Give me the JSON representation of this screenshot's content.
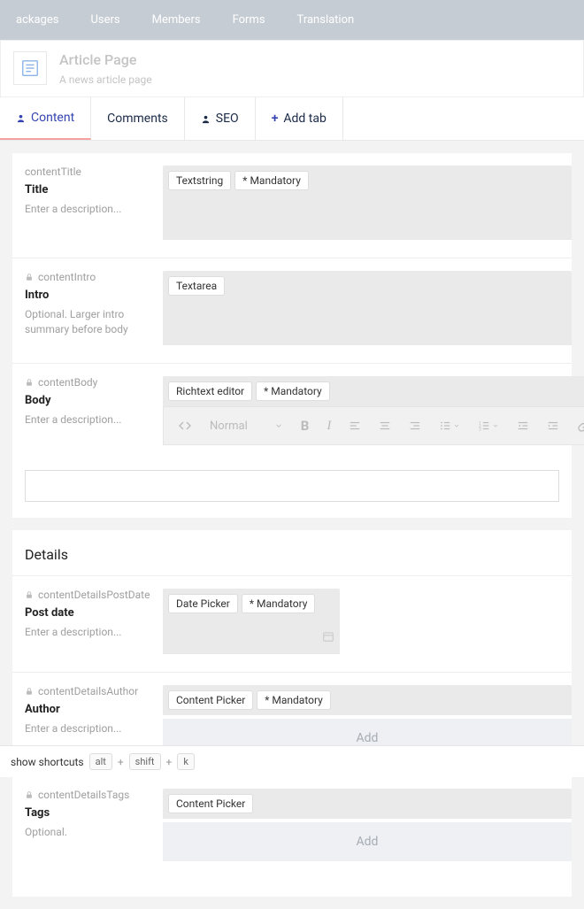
{
  "nav": {
    "items": [
      "ackages",
      "Users",
      "Members",
      "Forms",
      "Translation"
    ]
  },
  "header": {
    "title": "Article Page",
    "subtitle": "A news article page"
  },
  "tabs": {
    "content": "Content",
    "comments": "Comments",
    "seo": "SEO",
    "add": "Add tab"
  },
  "fields": {
    "title": {
      "alias": "contentTitle",
      "label": "Title",
      "desc": "Enter a description...",
      "type": "Textstring",
      "mandatory": "* Mandatory"
    },
    "intro": {
      "alias": "contentIntro",
      "label": "Intro",
      "desc": "Optional. Larger intro summary before body",
      "type": "Textarea"
    },
    "body": {
      "alias": "contentBody",
      "label": "Body",
      "desc": "Enter a description...",
      "type": "Richtext editor",
      "mandatory": "* Mandatory"
    }
  },
  "rte": {
    "format": "Normal"
  },
  "section_details": "Details",
  "details": {
    "postdate": {
      "alias": "contentDetailsPostDate",
      "label": "Post date",
      "desc": "Enter a description...",
      "type": "Date Picker",
      "mandatory": "* Mandatory"
    },
    "author": {
      "alias": "contentDetailsAuthor",
      "label": "Author",
      "desc": "Enter a description...",
      "type": "Content Picker",
      "mandatory": "* Mandatory",
      "add": "Add"
    },
    "tags": {
      "alias": "contentDetailsTags",
      "label": "Tags",
      "desc": "Optional.",
      "type": "Content Picker",
      "add": "Add"
    }
  },
  "footer": {
    "label": "show shortcuts",
    "keys": [
      "alt",
      "shift",
      "k"
    ],
    "sep": "+"
  }
}
